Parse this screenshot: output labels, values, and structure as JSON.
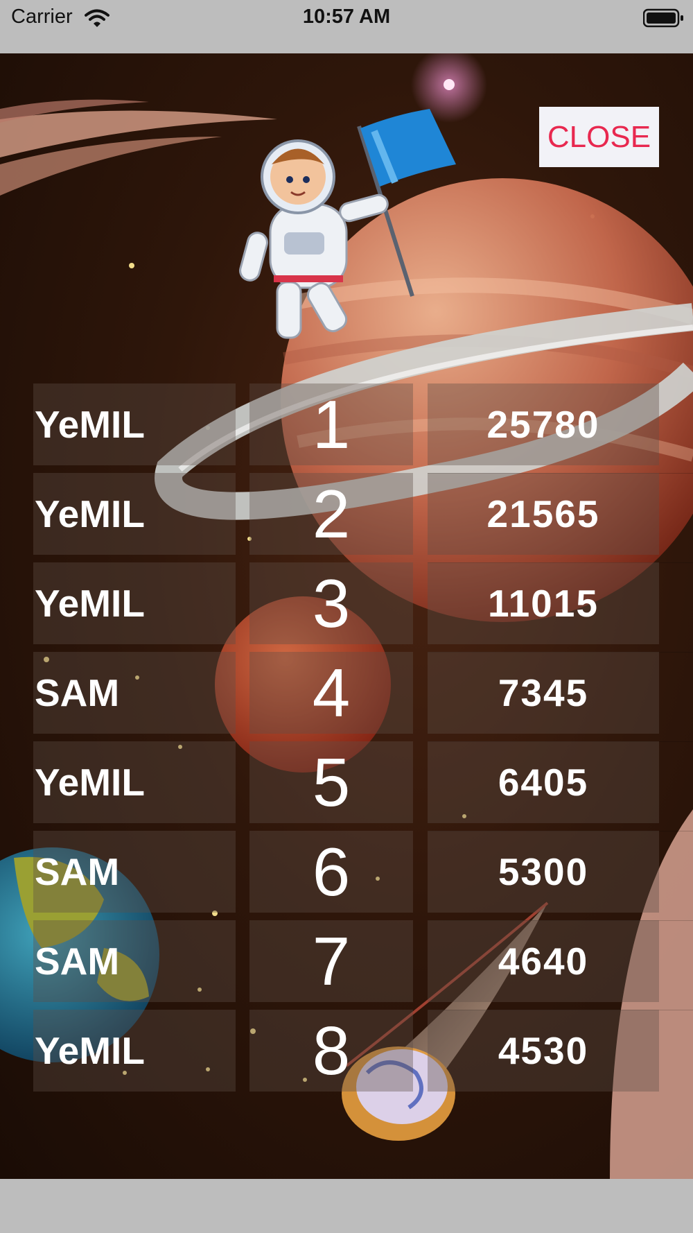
{
  "status_bar": {
    "carrier": "Carrier",
    "time": "10:57 AM",
    "wifi_icon": "wifi-icon",
    "battery_icon": "battery-icon"
  },
  "close_button": {
    "label": "CLOSE",
    "text_color": "#e8284f",
    "background": "#f2f2f7"
  },
  "leaderboard": [
    {
      "name": "YeMIL",
      "rank": "1",
      "score": "25780"
    },
    {
      "name": "YeMIL",
      "rank": "2",
      "score": "21565"
    },
    {
      "name": "YeMIL",
      "rank": "3",
      "score": "11015"
    },
    {
      "name": "SAM",
      "rank": "4",
      "score": "7345"
    },
    {
      "name": "YeMIL",
      "rank": "5",
      "score": "6405"
    },
    {
      "name": "SAM",
      "rank": "6",
      "score": "5300"
    },
    {
      "name": "SAM",
      "rank": "7",
      "score": "4640"
    },
    {
      "name": "YeMIL",
      "rank": "8",
      "score": "4530"
    }
  ],
  "background": {
    "scene": "space",
    "elements": [
      "astronaut",
      "flag",
      "ringed-planet",
      "mars-planet",
      "earth-planet",
      "comet",
      "stars"
    ]
  }
}
